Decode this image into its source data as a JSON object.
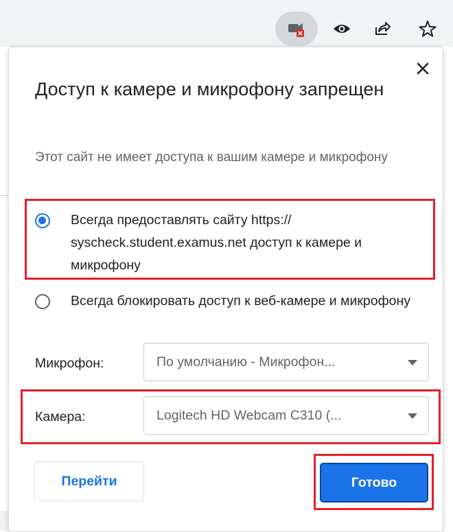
{
  "toolbar": {
    "icons": [
      "camera-blocked-icon",
      "eye-icon",
      "share-icon",
      "star-icon"
    ]
  },
  "dialog": {
    "title": "Доступ к камере и микрофону запрещен",
    "subtitle": "Этот сайт не имеет доступа к вашим камере и микрофону",
    "options": [
      {
        "label": "Всегда предоставлять сайту https:// syscheck.student.examus.net доступ к камере и микрофону",
        "selected": true
      },
      {
        "label": "Всегда блокировать доступ к веб-камере и микрофону",
        "selected": false
      }
    ],
    "microphone": {
      "label": "Микрофон:",
      "value": "По умолчанию - Микрофон..."
    },
    "camera": {
      "label": "Камера:",
      "value": "Logitech HD Webcam C310 (..."
    },
    "buttons": {
      "go": "Перейти",
      "done": "Готово"
    }
  },
  "colors": {
    "accent": "#1a73e8",
    "highlight": "#e41e2d",
    "blocked_badge": "#d93025"
  }
}
